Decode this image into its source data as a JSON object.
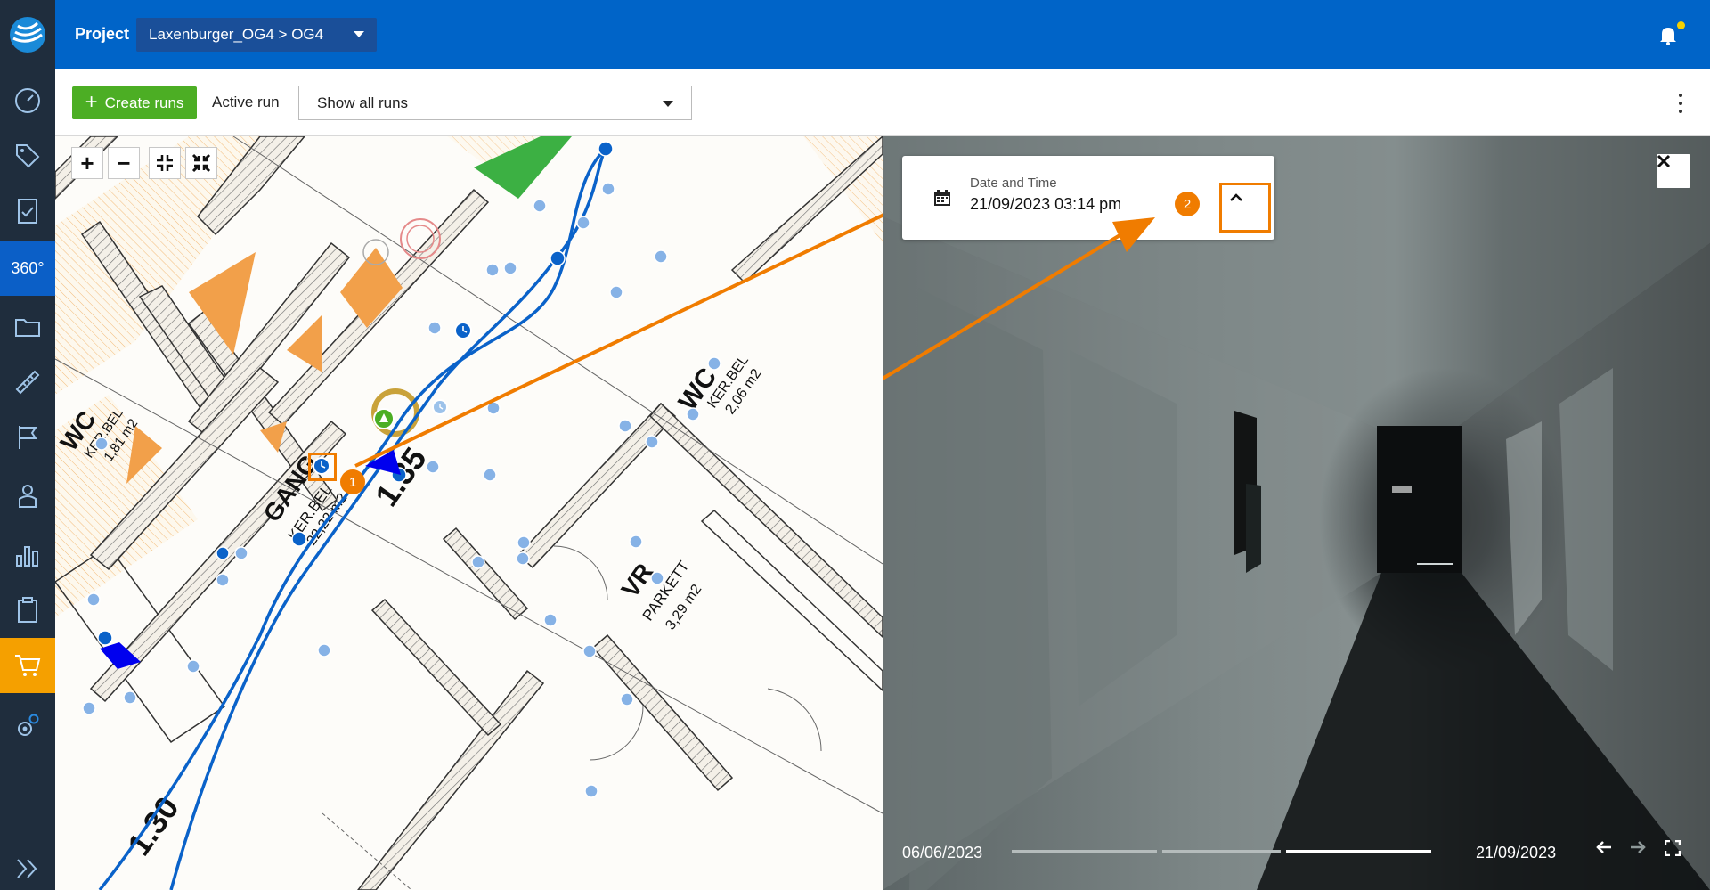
{
  "header": {
    "project_label": "Project",
    "project_value": "Laxenburger_OG4 > OG4"
  },
  "sidebar": {
    "items": [
      {
        "name": "dashboard-icon"
      },
      {
        "name": "tag-icon"
      },
      {
        "name": "document-check-icon"
      },
      {
        "name": "360-view",
        "label": "360°"
      },
      {
        "name": "folder-icon"
      },
      {
        "name": "ruler-icon"
      },
      {
        "name": "flag-icon"
      },
      {
        "name": "user-icon"
      },
      {
        "name": "bar-chart-icon"
      },
      {
        "name": "clipboard-icon"
      },
      {
        "name": "cart-icon"
      },
      {
        "name": "settings-gear-icon"
      },
      {
        "name": "expand-chevrons-icon"
      }
    ]
  },
  "toolbar": {
    "create_label": "Create runs",
    "active_run_label": "Active run",
    "run_select_value": "Show all runs"
  },
  "map": {
    "controls": [
      "+",
      "−"
    ],
    "plan_labels": {
      "wc_left": "WC",
      "wc_left_sub1": "KER.BEL",
      "wc_left_sub2": "1,81 m2",
      "gang": "GANG",
      "gang_sub1": "KER.BEL",
      "gang_sub2": "22,22 m2",
      "wc_right": "WC",
      "wc_right_sub1": "KER.BEL",
      "wc_right_sub2": "2,06 m2",
      "vr": "VR",
      "vr_sub1": "PARKETT",
      "vr_sub2": "3,29 m2",
      "num_135": "1.35",
      "num_130": "1.30"
    }
  },
  "annotations": {
    "badge_1": "1",
    "badge_2": "2"
  },
  "viewer": {
    "date_time_title": "Date and Time",
    "date_time_value": "21/09/2023 03:14 pm",
    "timeline_start": "06/06/2023",
    "timeline_end": "21/09/2023"
  },
  "colors": {
    "brand_blue": "#0064c8",
    "sidebar_bg": "#1f2d3d",
    "create_green": "#4cae24",
    "accent_orange": "#f07c00",
    "path_blue": "#0a62c9"
  }
}
